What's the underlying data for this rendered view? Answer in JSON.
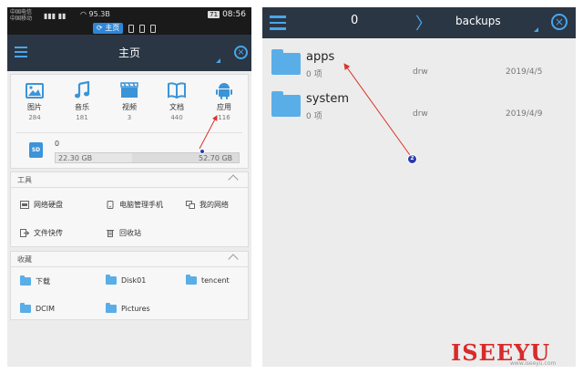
{
  "left_screen": {
    "status_bar": {
      "carrier_top": "中国电信",
      "carrier_bottom": "中国移动",
      "signal": "▮▮▮ ▮▮",
      "network_speed": "95.3B",
      "battery_level": "71",
      "time": "08:56",
      "active_tab": "⟳ 主页"
    },
    "header": {
      "title": "主页"
    },
    "categories": [
      {
        "label": "图片",
        "count": "284",
        "icon": "image-icon"
      },
      {
        "label": "音乐",
        "count": "181",
        "icon": "music-icon"
      },
      {
        "label": "视频",
        "count": "3",
        "icon": "video-icon"
      },
      {
        "label": "文档",
        "count": "440",
        "icon": "document-icon"
      },
      {
        "label": "应用",
        "count": "116",
        "icon": "android-icon"
      }
    ],
    "storage": {
      "badge": "SD",
      "count": "0",
      "used": "22.30 GB",
      "total": "52.70 GB",
      "used_fraction": 0.42
    },
    "tools": {
      "title": "工具",
      "items": [
        {
          "label": "网络硬盘",
          "icon": "cloud-drive-icon"
        },
        {
          "label": "电脑管理手机",
          "icon": "pc-manage-icon"
        },
        {
          "label": "我的网络",
          "icon": "network-icon"
        },
        {
          "label": "文件快传",
          "icon": "transfer-icon"
        },
        {
          "label": "回收站",
          "icon": "recycle-bin-icon"
        }
      ]
    },
    "favorites": {
      "title": "收藏",
      "items": [
        {
          "label": "下载"
        },
        {
          "label": "Disk01"
        },
        {
          "label": "tencent"
        },
        {
          "label": "DCIM"
        },
        {
          "label": "Pictures"
        }
      ]
    }
  },
  "right_screen": {
    "header": {
      "item_count": "0",
      "separator": "〉",
      "breadcrumb": "backups"
    },
    "files": [
      {
        "name": "apps",
        "count": "0 项",
        "permissions": "drw",
        "date": "2019/4/5"
      },
      {
        "name": "system",
        "count": "0 项",
        "permissions": "drw",
        "date": "2019/4/9"
      }
    ],
    "annotation_marker": "2"
  },
  "watermark": {
    "text": "ISEEYU",
    "sub": "www.iseeyu.com"
  },
  "colors": {
    "appbar": "#2a3644",
    "accent": "#4aa6e8",
    "folder": "#5aaee8",
    "annotation": "#d9342b",
    "marker": "#2b3bb0",
    "watermark": "#d92a2a"
  }
}
